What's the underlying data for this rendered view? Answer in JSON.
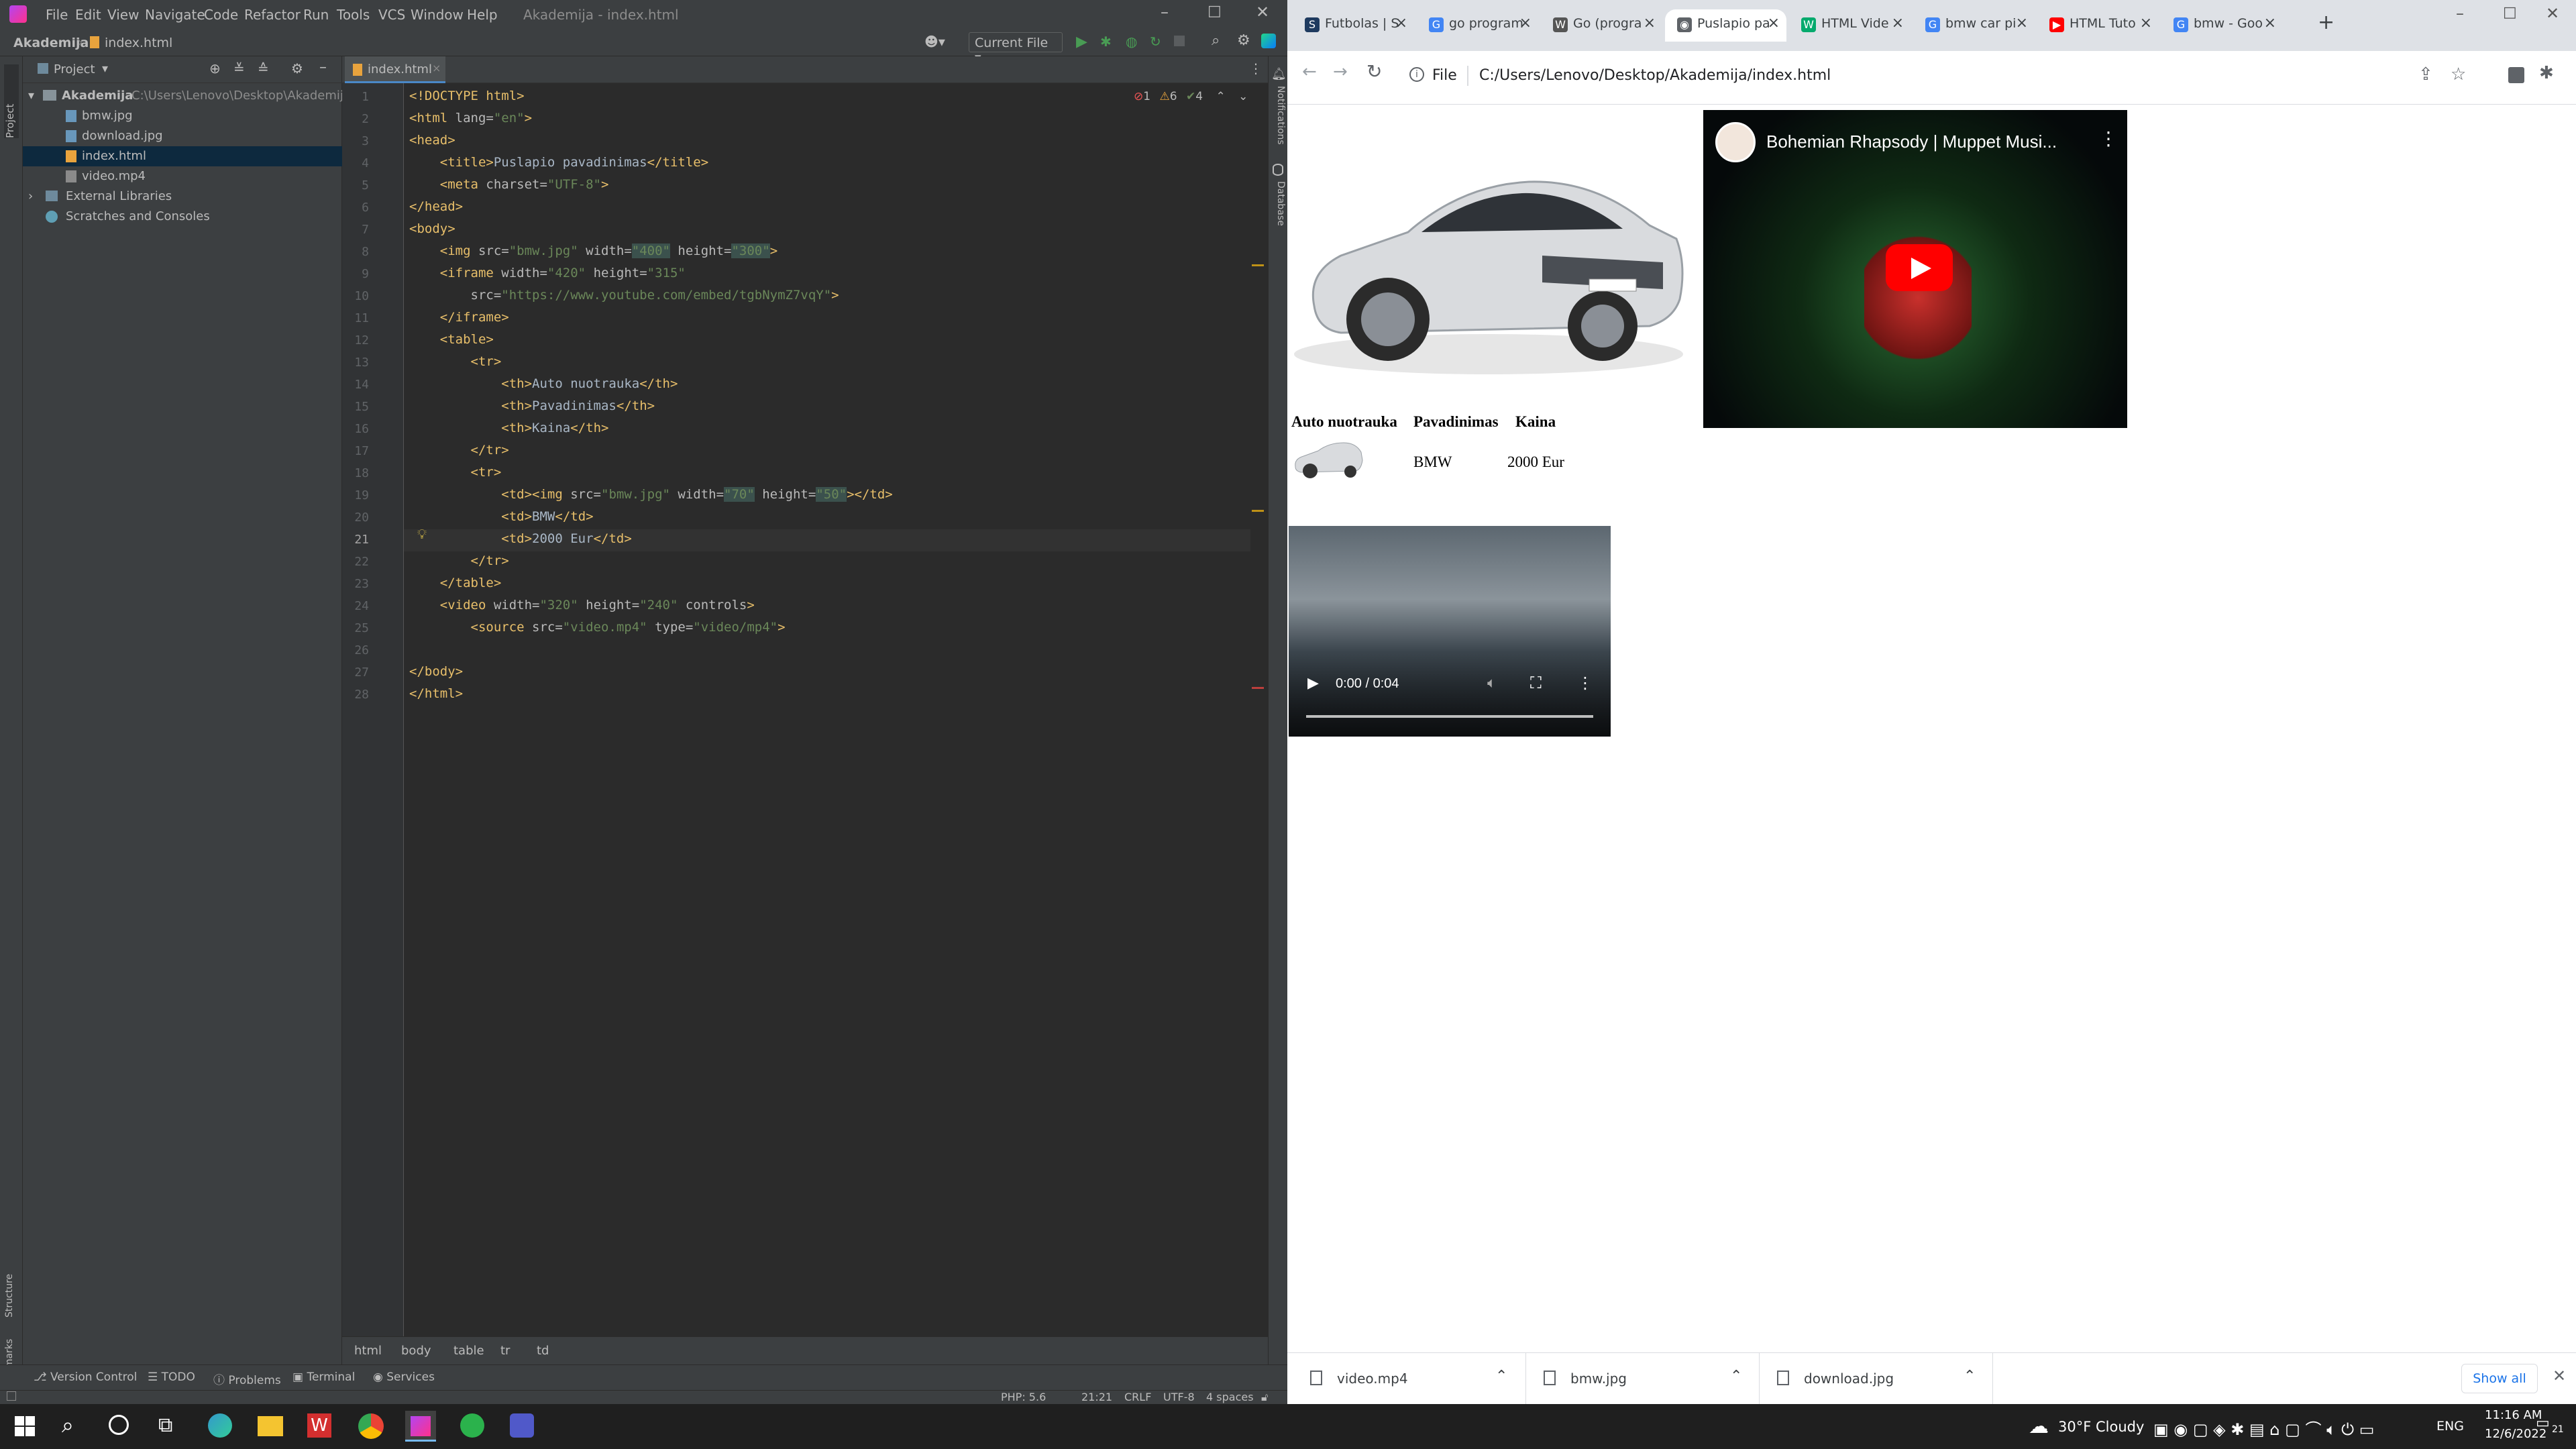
{
  "ide": {
    "menu": [
      "File",
      "Edit",
      "View",
      "Navigate",
      "Code",
      "Refactor",
      "Run",
      "Tools",
      "VCS",
      "Window",
      "Help"
    ],
    "window_title": "Akademija - index.html",
    "nav": {
      "project": "Akademija",
      "file": "index.html",
      "run_config": "Current File"
    },
    "project_panel": {
      "title": "Project",
      "root_name": "Akademija",
      "root_path": "C:\\Users\\Lenovo\\Desktop\\Akademija",
      "files": [
        "bmw.jpg",
        "download.jpg",
        "index.html",
        "video.mp4"
      ],
      "external": "External Libraries",
      "scratches": "Scratches and Consoles"
    },
    "left_stripe": {
      "project": "Project",
      "structure": "Structure",
      "bookmarks": "Bookmarks"
    },
    "right_stripe": {
      "notifications": "Notifications",
      "database": "Database"
    },
    "editor_tab": "index.html",
    "inspections": {
      "errors": "1",
      "warnings": "6",
      "weak": "4"
    },
    "line_numbers": [
      "1",
      "2",
      "3",
      "4",
      "5",
      "6",
      "7",
      "8",
      "9",
      "10",
      "11",
      "12",
      "13",
      "14",
      "15",
      "16",
      "17",
      "18",
      "19",
      "20",
      "21",
      "22",
      "23",
      "24",
      "25",
      "26",
      "27",
      "28"
    ],
    "code": {
      "l1": "<!DOCTYPE html>",
      "l2_open": "<html ",
      "l2_attr": "lang=",
      "l2_val": "\"en\"",
      "l2_close": ">",
      "l3": "<head>",
      "l4_open": "<title>",
      "l4_text": "Puslapio pavadinimas",
      "l4_close": "</title>",
      "l5_open": "<meta ",
      "l5_attr": "charset=",
      "l5_val": "\"UTF-8\"",
      "l5_close": ">",
      "l6": "</head>",
      "l7": "<body>",
      "l8_open": "<img ",
      "l8_a1": "src=",
      "l8_v1": "\"bmw.jpg\"",
      "l8_a2": " width=",
      "l8_v2": "\"400\"",
      "l8_a3": " height=",
      "l8_v3": "\"300\"",
      "l8_close": ">",
      "l9_open": "<iframe ",
      "l9_a1": "width=",
      "l9_v1": "\"420\"",
      "l9_a2": " height=",
      "l9_v2": "\"315\"",
      "l10_a": "src=",
      "l10_v": "\"https://www.youtube.com/embed/tgbNymZ7vqY\"",
      "l10_close": ">",
      "l11": "</iframe>",
      "l12": "<table>",
      "l13": "<tr>",
      "l14_open": "<th>",
      "l14_text": "Auto nuotrauka",
      "l14_close": "</th>",
      "l15_open": "<th>",
      "l15_text": "Pavadinimas",
      "l15_close": "</th>",
      "l16_open": "<th>",
      "l16_text": "Kaina",
      "l16_close": "</th>",
      "l17": "</tr>",
      "l18": "<tr>",
      "l19_open": "<td><img ",
      "l19_a1": "src=",
      "l19_v1": "\"bmw.jpg\"",
      "l19_a2": " width=",
      "l19_v2": "\"70\"",
      "l19_a3": " height=",
      "l19_v3": "\"50\"",
      "l19_close": "></td>",
      "l20_open": "<td>",
      "l20_text": "BMW",
      "l20_close": "</td>",
      "l21_open": "<td>",
      "l21_text": "2000 Eur",
      "l21_close": "</td>",
      "l22": "</tr>",
      "l23": "</table>",
      "l24_open": "<video ",
      "l24_a1": "width=",
      "l24_v1": "\"320\"",
      "l24_a2": " height=",
      "l24_v2": "\"240\"",
      "l24_a3": " controls",
      "l24_close": ">",
      "l25_open": "<source ",
      "l25_a1": "src=",
      "l25_v1": "\"video.mp4\"",
      "l25_a2": " type=",
      "l25_v2": "\"video/mp4\"",
      "l25_close": ">",
      "l27": "</body>",
      "l28": "</html>"
    },
    "breadcrumbs": [
      "html",
      "body",
      "table",
      "tr",
      "td"
    ],
    "tool_tabs": [
      "Version Control",
      "TODO",
      "Problems",
      "Terminal",
      "Services"
    ],
    "status": {
      "php": "PHP: 5.6",
      "position": "21:21",
      "line_sep": "CRLF",
      "encoding": "UTF-8",
      "indent": "4 spaces"
    }
  },
  "browser": {
    "tabs": [
      {
        "title": "Futbolas | S",
        "icon": "S",
        "color": "#1e3a5f"
      },
      {
        "title": "go program",
        "icon": "G",
        "color": "#4285f4"
      },
      {
        "title": "Go (progra",
        "icon": "W",
        "color": "#555555"
      },
      {
        "title": "Puslapio pa",
        "icon": "◉",
        "color": "#5f6368"
      },
      {
        "title": "HTML Vide",
        "icon": "W",
        "color": "#04aa6d"
      },
      {
        "title": "bmw car pi",
        "icon": "G",
        "color": "#4285f4"
      },
      {
        "title": "HTML Tuto",
        "icon": "▶",
        "color": "#ff0000"
      },
      {
        "title": "bmw - Goo",
        "icon": "G",
        "color": "#4285f4"
      }
    ],
    "address": {
      "scheme": "File",
      "url": "C:/Users/Lenovo/Desktop/Akademija/index.html"
    },
    "page": {
      "youtube_title": "Bohemian Rhapsody | Muppet Musi...",
      "table_headers": [
        "Auto nuotrauka",
        "Pavadinimas",
        "Kaina"
      ],
      "row": {
        "name": "BMW",
        "price": "2000 Eur"
      },
      "video_time": "0:00 / 0:04"
    },
    "downloads": [
      "video.mp4",
      "bmw.jpg",
      "download.jpg"
    ],
    "show_all": "Show all"
  },
  "taskbar": {
    "weather": "30°F  Cloudy",
    "lang": "ENG",
    "time": "11:16 AM",
    "date": "12/6/2022",
    "notif_count": "21"
  },
  "colors": {
    "ide_bg": "#2b2b2b",
    "ide_panel": "#3c3f41",
    "tag": "#e8bf6a",
    "string": "#6a8759",
    "selection": "#0d293e"
  }
}
